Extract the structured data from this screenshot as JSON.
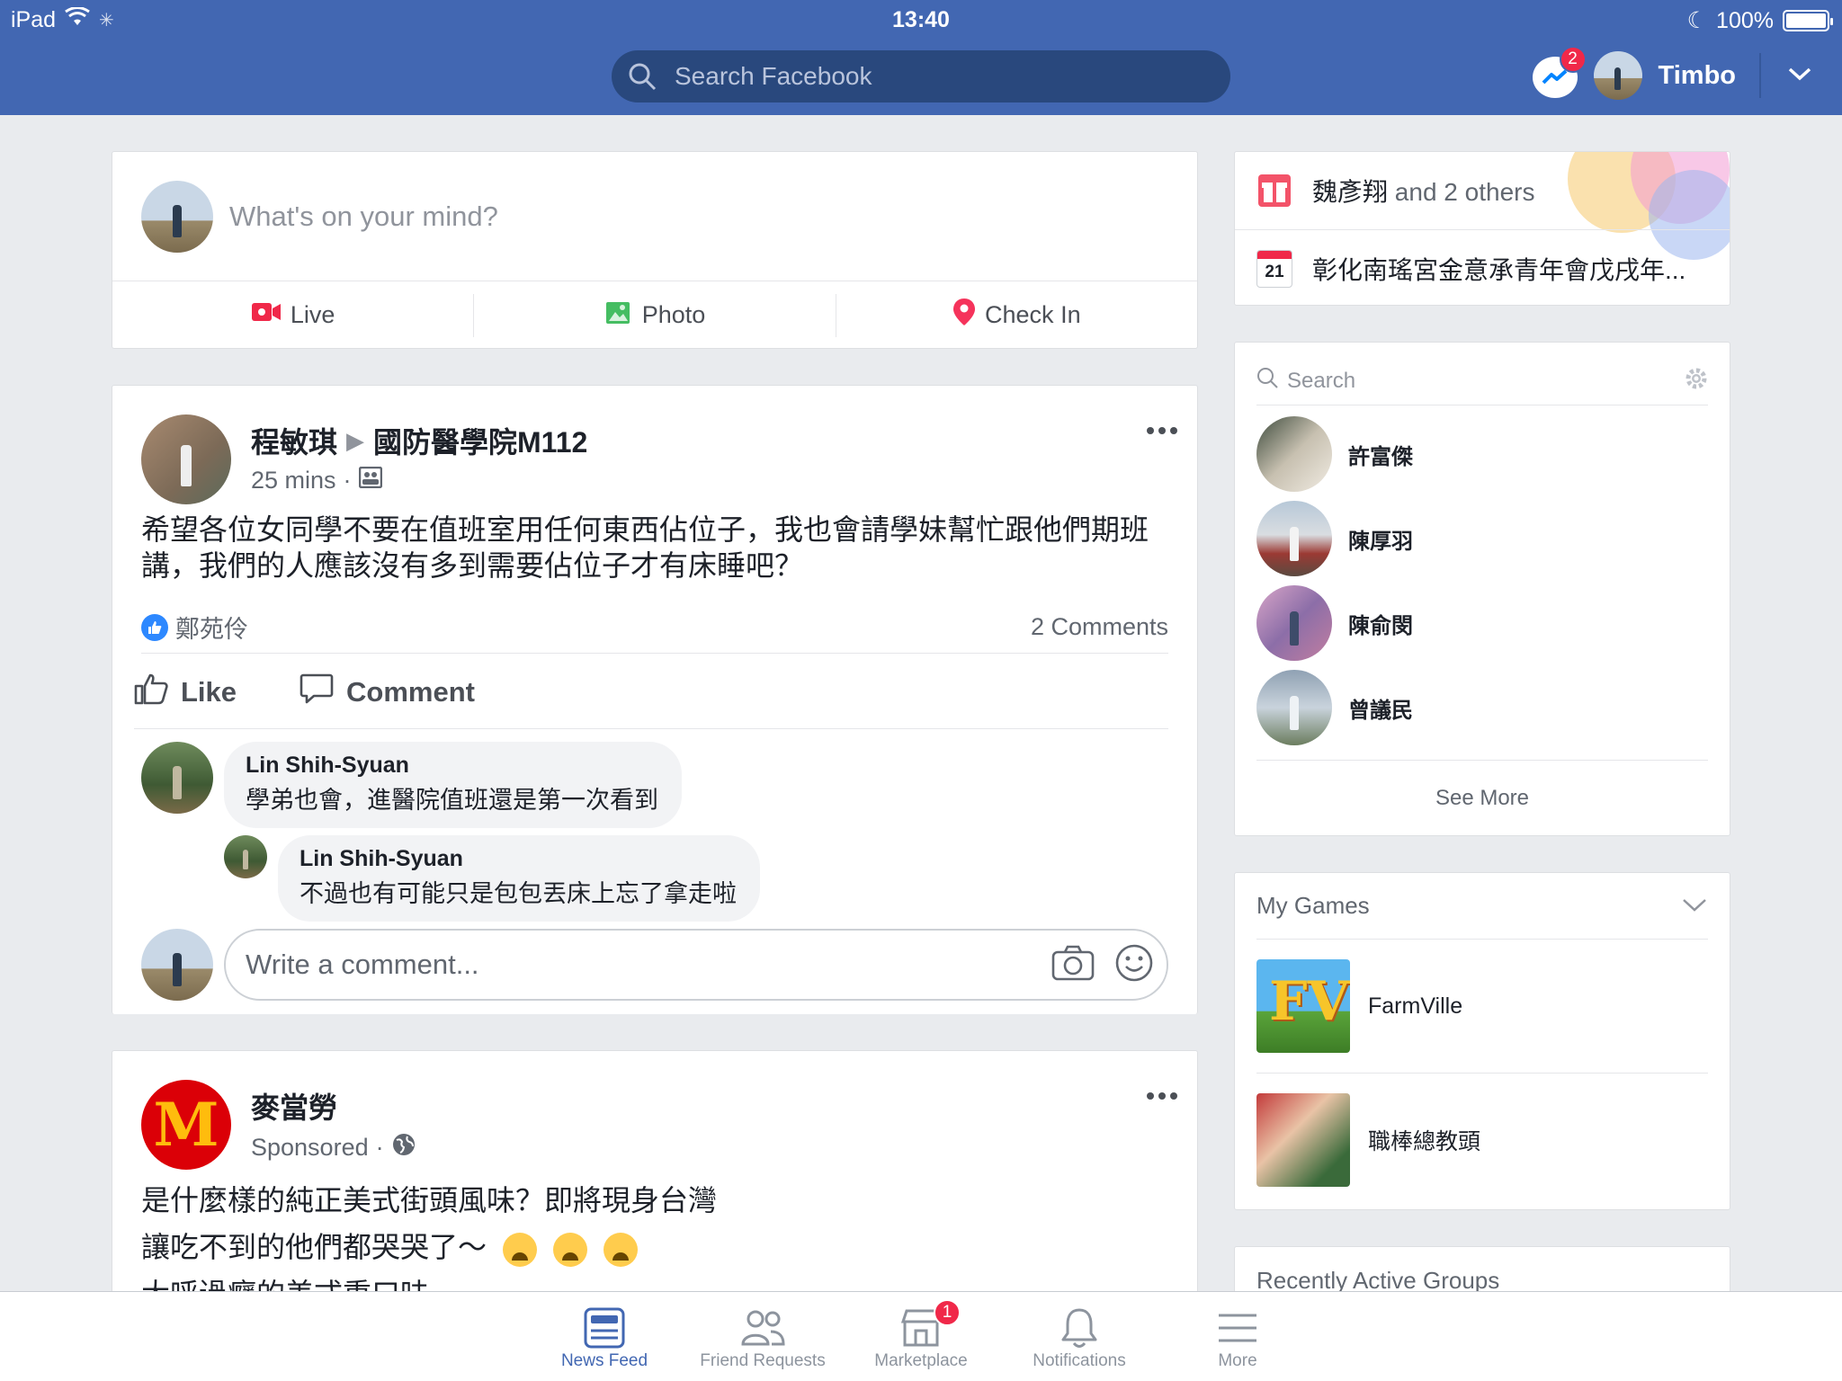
{
  "status_bar": {
    "device": "iPad",
    "time": "13:40",
    "battery": "100%"
  },
  "header": {
    "search_placeholder": "Search Facebook",
    "messenger_badge": "2",
    "user_name": "Timbo"
  },
  "composer": {
    "placeholder": "What's on your mind?",
    "actions": [
      "Live",
      "Photo",
      "Check In"
    ]
  },
  "post1": {
    "author": "程敏琪",
    "target": "國防醫學院M112",
    "time": "25 mins",
    "text": "希望各位女同學不要在值班室用任何東西佔位子，我也會請學妹幫忙跟他們期班講，我們的人應該沒有多到需要佔位子才有床睡吧？",
    "liker": "鄭苑伶",
    "comments_count": "2 Comments",
    "actions": [
      "Like",
      "Comment"
    ],
    "comments": [
      {
        "name": "Lin Shih-Syuan",
        "text": "學弟也會，進醫院值班還是第一次看到"
      },
      {
        "name": "Lin Shih-Syuan",
        "text": "不過也有可能只是包包丟床上忘了拿走啦"
      }
    ],
    "write_placeholder": "Write a comment..."
  },
  "post2": {
    "author": "麥當勞",
    "meta": "Sponsored",
    "line1": "是什麼樣的純正美式街頭風味？即將現身台灣",
    "line2": "讓吃不到的他們都哭哭了～",
    "line3": "大呼過癮的美式重口味"
  },
  "right": {
    "birthday": {
      "name": "魏彥翔",
      "rest": " and 2 others"
    },
    "event": {
      "day": "21",
      "title": "彰化南瑤宮金意承青年會戊戌年..."
    },
    "contacts_search": "Search",
    "contacts": [
      "許富傑",
      "陳厚羽",
      "陳俞閔",
      "曾議民"
    ],
    "see_more": "See More",
    "games_title": "My Games",
    "games": [
      "FarmVille",
      "職棒總教頭"
    ],
    "groups_title": "Recently Active Groups"
  },
  "tabs": [
    {
      "label": "News Feed",
      "active": true
    },
    {
      "label": "Friend Requests"
    },
    {
      "label": "Marketplace",
      "badge": "1"
    },
    {
      "label": "Notifications"
    },
    {
      "label": "More"
    }
  ],
  "colors": {
    "brand": "#4267b2",
    "badge": "#f02849",
    "background": "#e9ebee"
  }
}
